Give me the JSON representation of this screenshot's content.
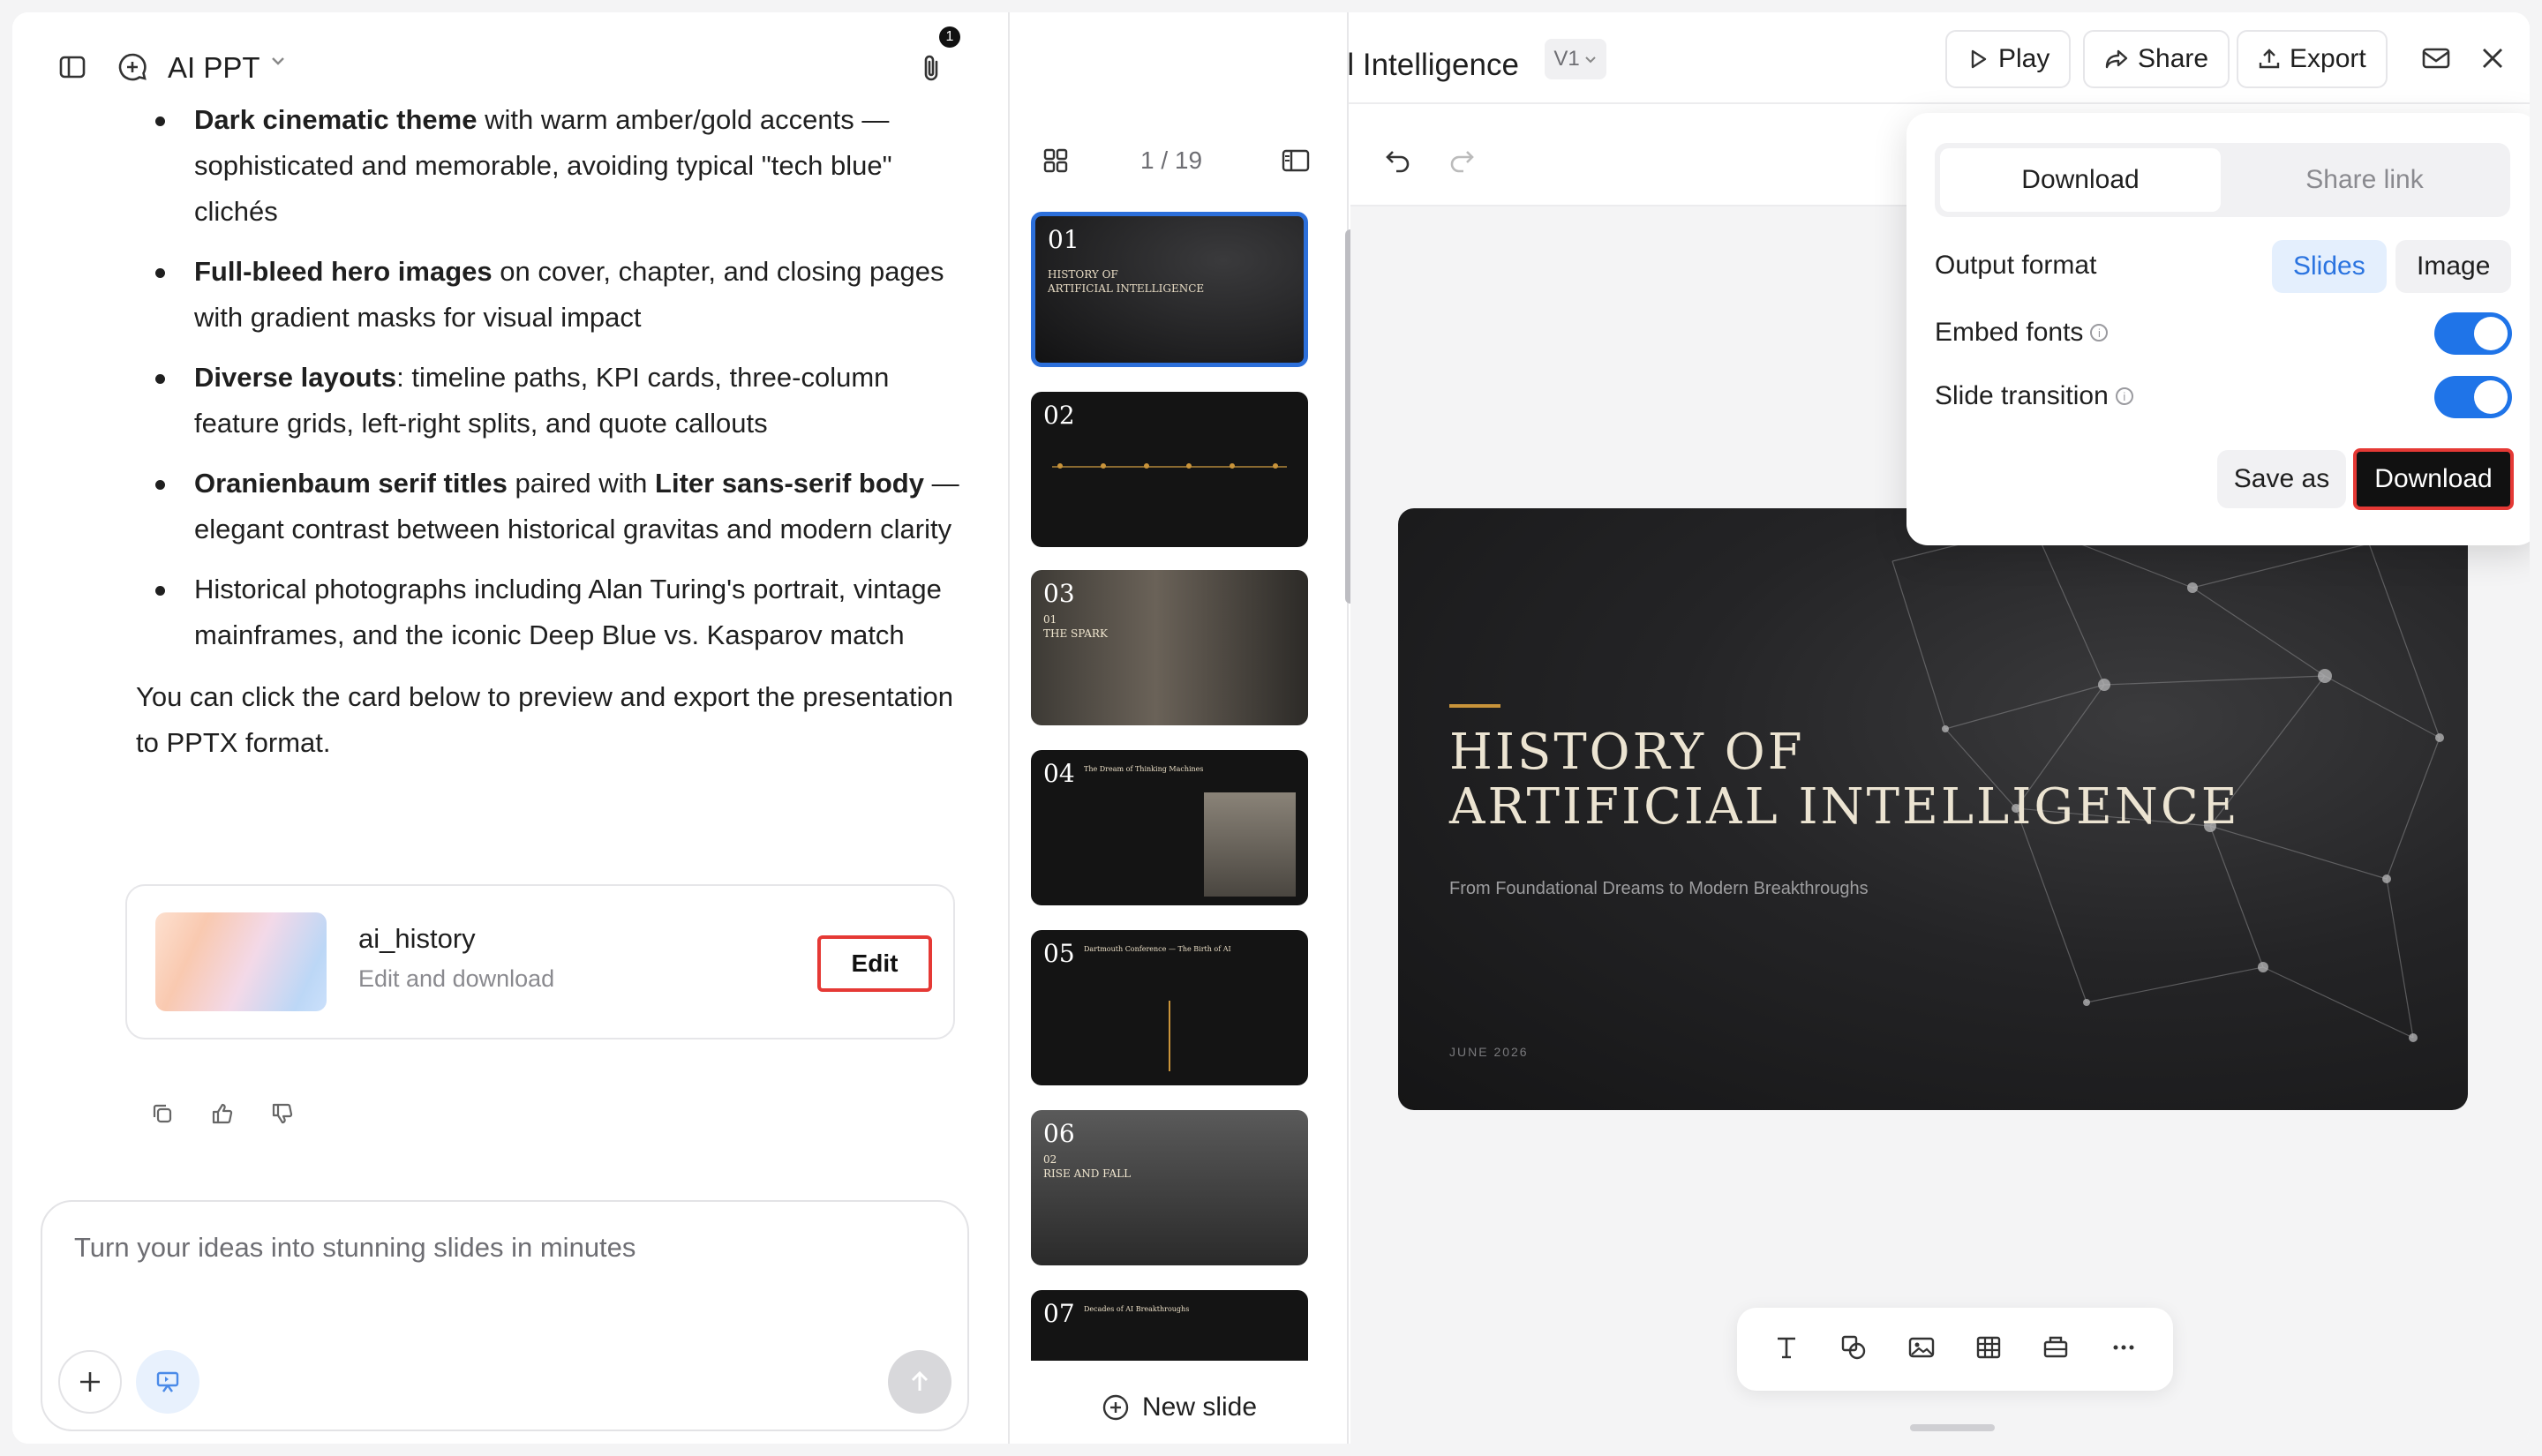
{
  "chat": {
    "app_name": "AI PPT",
    "attachment_count": "1",
    "bullets": [
      {
        "bold": "Dark cinematic theme",
        "rest": " with warm amber/gold accents — sophisticated and memorable, avoiding typical \"tech blue\" clichés"
      },
      {
        "bold": "Full-bleed hero images",
        "rest": " on cover, chapter, and closing pages with gradient masks for visual impact"
      },
      {
        "bold": "Diverse layouts",
        "rest": ": timeline paths, KPI cards, three-column feature grids, left-right splits, and quote callouts"
      },
      {
        "bold": "Oranienbaum serif titles",
        "rest": " paired with ",
        "bold2": "Liter sans-serif body",
        "rest2": " — elegant contrast between historical gravitas and modern clarity"
      },
      {
        "bold": "",
        "rest": "Historical photographs including Alan Turing's portrait, vintage mainframes, and the iconic Deep Blue vs. Kasparov match"
      }
    ],
    "closing_text": "You can click the card below to preview and export the presentation to PPTX format.",
    "card": {
      "title": "ai_history",
      "subtitle": "Edit and download",
      "edit_label": "Edit"
    },
    "composer_placeholder": "Turn your ideas into stunning slides in minutes"
  },
  "doc": {
    "title": "History of Artificial Intelligence",
    "version": "V1",
    "play_label": "Play",
    "share_label": "Share",
    "export_label": "Export"
  },
  "slides_panel": {
    "counter": "1 / 19",
    "new_slide_label": "New slide",
    "thumbs": [
      {
        "num": "01",
        "title": "HISTORY OF\nARTIFICIAL INTELLIGENCE"
      },
      {
        "num": "02",
        "title": ""
      },
      {
        "num": "03",
        "title": "01\nTHE SPARK"
      },
      {
        "num": "04",
        "title": "The Dream of Thinking Machines"
      },
      {
        "num": "05",
        "title": "Dartmouth Conference — The Birth of AI"
      },
      {
        "num": "06",
        "title": "02\nRISE AND FALL"
      },
      {
        "num": "07",
        "title": "Decades of AI Breakthroughs"
      }
    ]
  },
  "main_slide": {
    "title_line1": "HISTORY OF",
    "title_line2": "ARTIFICIAL INTELLIGENCE",
    "subtitle": "From Foundational Dreams to Modern Breakthroughs",
    "date": "JUNE 2026",
    "accent_color": "#c9943a"
  },
  "export_popover": {
    "tab_download": "Download",
    "tab_share_link": "Share link",
    "output_format_label": "Output format",
    "format_slides": "Slides",
    "format_image": "Image",
    "embed_fonts_label": "Embed fonts",
    "embed_fonts_on": true,
    "slide_transition_label": "Slide transition",
    "slide_transition_on": true,
    "save_as_label": "Save as",
    "download_label": "Download"
  },
  "colors": {
    "accent_blue": "#1f74e8",
    "highlight_red": "#e53935"
  }
}
